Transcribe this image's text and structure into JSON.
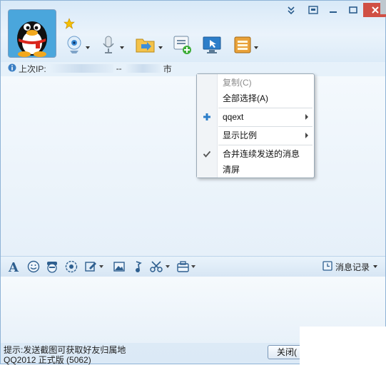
{
  "header": {
    "ip_label": "上次IP:",
    "ip_dash": "--",
    "ip_city": "市"
  },
  "toolbar_top": {
    "icons": [
      "video-icon",
      "mic-icon",
      "folder-send-icon",
      "add-app-icon",
      "remote-desktop-icon",
      "app-box-icon"
    ]
  },
  "context_menu": {
    "items": [
      {
        "label": "复制(C)",
        "disabled": true
      },
      {
        "label": "全部选择(A)",
        "disabled": false
      },
      {
        "label": "qqext",
        "submenu": true
      },
      {
        "label": "显示比例",
        "submenu": true
      },
      {
        "label": "合并连续发送的消息",
        "checked": true
      },
      {
        "label": "清屏",
        "disabled": false
      }
    ]
  },
  "edit_toolbar": {
    "history_label": "消息记录",
    "icons": [
      "font-icon",
      "emoji-icon",
      "face-icon",
      "magic-icon",
      "edit-icon",
      "image-icon",
      "music-icon",
      "screenshot-icon",
      "toolbox-icon"
    ]
  },
  "status": {
    "tip": "提示:发送截图可获取好友归属地",
    "version": "QQ2012 正式版 (5062)"
  },
  "buttons": {
    "close_label": "关闭("
  },
  "colors": {
    "accent": "#2f7fc8",
    "close_red": "#d05045"
  }
}
